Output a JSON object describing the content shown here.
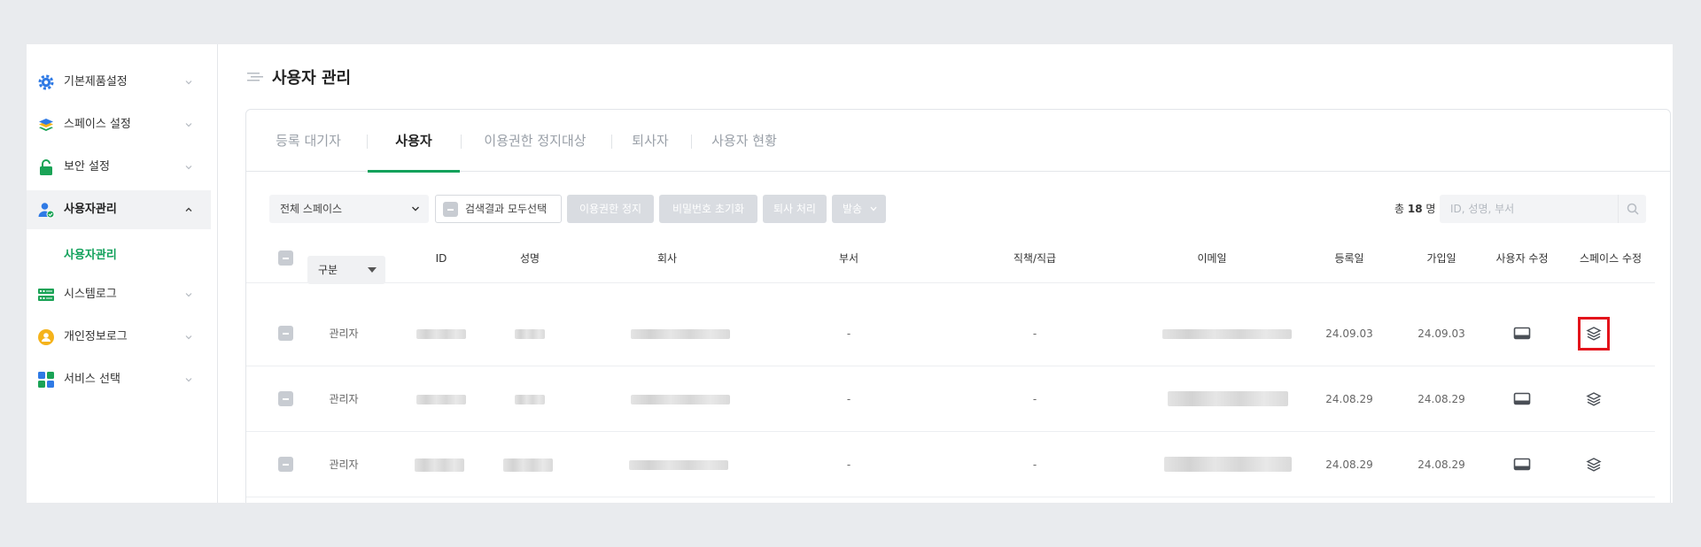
{
  "sidebar": {
    "items": [
      {
        "label": "기본제품설정",
        "icon": "gear-icon",
        "color": "#2f7ae5"
      },
      {
        "label": "스페이스 설정",
        "icon": "layers-icon",
        "color": "#1aa356"
      },
      {
        "label": "보안 설정",
        "icon": "lock-icon",
        "color": "#1aa356"
      },
      {
        "label": "사용자관리",
        "icon": "user-check-icon",
        "color": "#2f7ae5"
      },
      {
        "label": "시스템로그",
        "icon": "server-icon",
        "color": "#1aa356"
      },
      {
        "label": "개인정보로그",
        "icon": "person-circle-icon",
        "color": "#f5b31b"
      },
      {
        "label": "서비스 선택",
        "icon": "grid-icon",
        "color": "#2f7ae5"
      }
    ],
    "active_sub": "사용자관리"
  },
  "page": {
    "title": "사용자 관리"
  },
  "tabs": [
    "등록 대기자",
    "사용자",
    "이용권한 정지대상",
    "퇴사자",
    "사용자 현황"
  ],
  "active_tab": "사용자",
  "toolbar": {
    "space_select": "전체 스페이스",
    "select_all": "검색결과 모두선택",
    "buttons": [
      "이용권한 정지",
      "비밀번호 초기화",
      "퇴사 처리",
      "발송"
    ],
    "total_prefix": "총",
    "total_count": "18",
    "total_suffix": "명",
    "search_placeholder": "ID, 성명, 부서"
  },
  "table": {
    "type_select": "구분",
    "headers": [
      "ID",
      "성명",
      "회사",
      "부서",
      "직책/직급",
      "이메일",
      "등록일",
      "가입일",
      "사용자 수정",
      "스페이스 수정"
    ],
    "rows": [
      {
        "type": "관리자",
        "dept": "-",
        "position": "-",
        "registered": "24.09.03",
        "joined": "24.09.03"
      },
      {
        "type": "관리자",
        "dept": "-",
        "position": "-",
        "registered": "24.08.29",
        "joined": "24.08.29"
      },
      {
        "type": "관리자",
        "dept": "-",
        "position": "-",
        "registered": "24.08.29",
        "joined": "24.08.29"
      }
    ]
  },
  "colors": {
    "accent": "#12a15b",
    "highlight": "#e3131b",
    "disabled_button": "#d9dce1"
  }
}
